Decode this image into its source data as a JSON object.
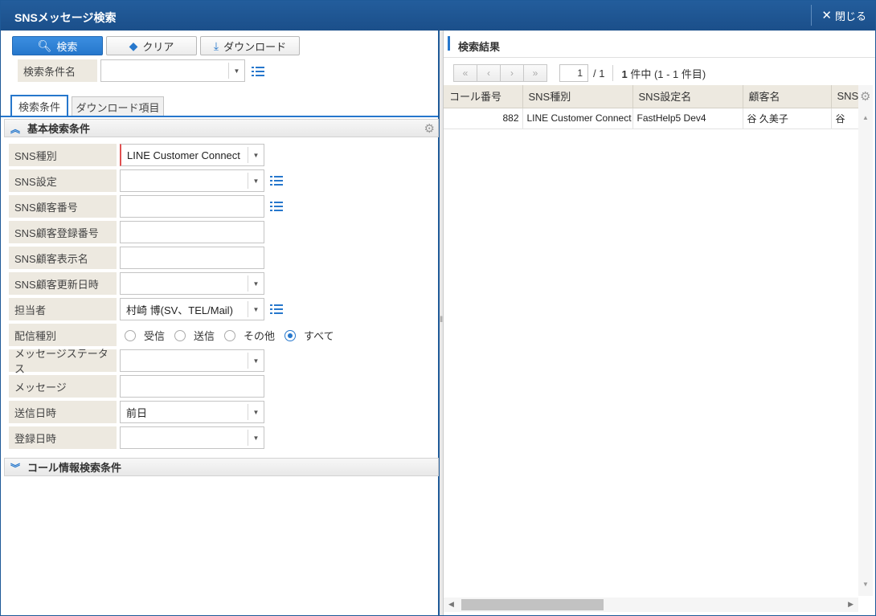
{
  "window": {
    "title": "SNSメッセージ検索",
    "close_label": "閉じる"
  },
  "toolbar": {
    "search": "検索",
    "clear": "クリア",
    "download": "ダウンロード"
  },
  "condition_name": {
    "label": "検索条件名",
    "value": ""
  },
  "tabs": [
    {
      "label": "検索条件"
    },
    {
      "label": "ダウンロード項目"
    }
  ],
  "sections": {
    "basic": "基本検索条件",
    "call": "コール情報検索条件"
  },
  "fields": {
    "sns_type": {
      "label": "SNS種別",
      "value": "LINE Customer Connect"
    },
    "sns_setting": {
      "label": "SNS設定",
      "value": ""
    },
    "sns_customer_no": {
      "label": "SNS顧客番号",
      "value": ""
    },
    "sns_customer_reg_no": {
      "label": "SNS顧客登録番号",
      "value": ""
    },
    "sns_customer_display": {
      "label": "SNS顧客表示名",
      "value": ""
    },
    "sns_customer_updated": {
      "label": "SNS顧客更新日時",
      "value": ""
    },
    "assignee": {
      "label": "担当者",
      "value": "村崎 博(SV、TEL/Mail)"
    },
    "delivery_type": {
      "label": "配信種別",
      "options": [
        "受信",
        "送信",
        "その他",
        "すべて"
      ],
      "selected": "すべて"
    },
    "message_status": {
      "label": "メッセージステータス",
      "value": ""
    },
    "message": {
      "label": "メッセージ",
      "value": ""
    },
    "sent_at": {
      "label": "送信日時",
      "value": "前日"
    },
    "registered_at": {
      "label": "登録日時",
      "value": ""
    }
  },
  "results": {
    "title": "検索結果",
    "pager": {
      "first": "«",
      "prev": "‹",
      "next": "›",
      "last": "»",
      "page": "1",
      "total_pages": "/ 1",
      "count_num": "1",
      "count_text": "件中 (1 - 1 件目)"
    },
    "columns": [
      "コール番号",
      "SNS種別",
      "SNS設定名",
      "顧客名",
      "SNS"
    ],
    "rows": [
      [
        "882",
        "LINE Customer Connect",
        "FastHelp5 Dev4",
        "谷 久美子",
        "谷"
      ]
    ]
  },
  "colors": {
    "primary": "#2677cc",
    "titlebar": "#1f5a98",
    "label_bg": "#ede9e0",
    "required": "#e05050"
  }
}
